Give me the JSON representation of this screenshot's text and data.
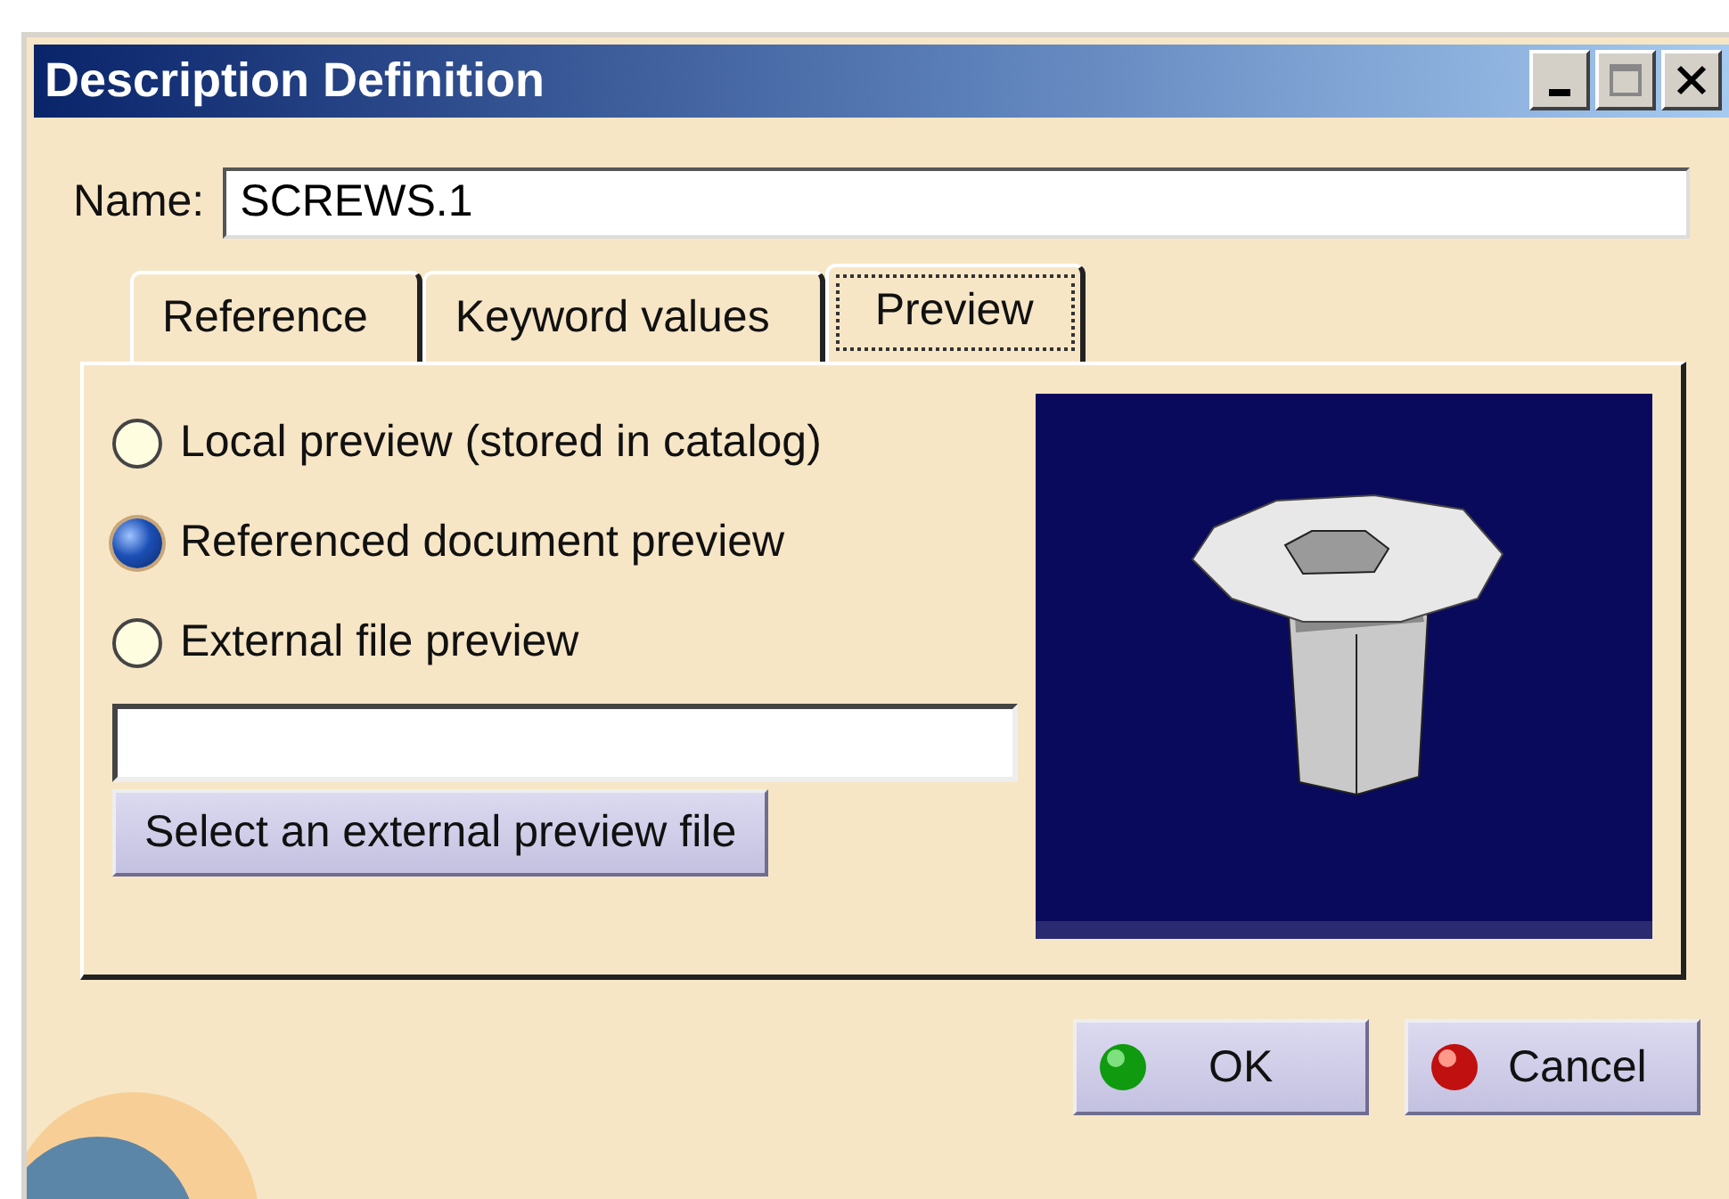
{
  "window": {
    "title": "Description Definition"
  },
  "name_field": {
    "label": "Name:",
    "value": "SCREWS.1"
  },
  "tabs": [
    {
      "label": "Reference",
      "selected": false
    },
    {
      "label": "Keyword values",
      "selected": false
    },
    {
      "label": "Preview",
      "selected": true
    }
  ],
  "preview_options": [
    {
      "label": "Local preview (stored in catalog)",
      "selected": false
    },
    {
      "label": "Referenced document preview",
      "selected": true
    },
    {
      "label": "External file preview",
      "selected": false
    }
  ],
  "select_file_button": "Select an external preview file",
  "buttons": [
    {
      "label": "OK",
      "kind": "ok"
    },
    {
      "label": "Cancel",
      "kind": "cancel"
    }
  ]
}
